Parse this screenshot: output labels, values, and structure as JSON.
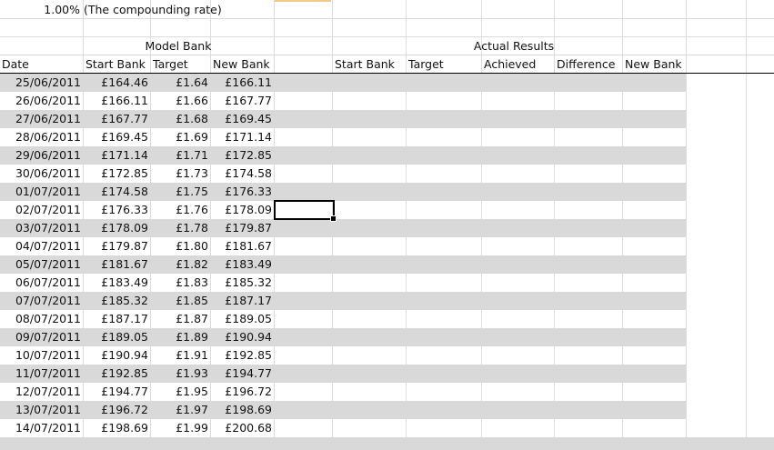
{
  "top": {
    "rate_value": "1.00%",
    "rate_note": "(The compounding rate)"
  },
  "headers": {
    "model_bank": "Model Bank",
    "actual_results": "Actual Results",
    "date": "Date",
    "start_bank": "Start Bank",
    "target": "Target",
    "new_bank": "New Bank",
    "actual_start_bank": "Start Bank",
    "actual_target": "Target",
    "achieved": "Achieved",
    "difference": "Difference",
    "actual_new_bank": "New Bank"
  },
  "rows": [
    {
      "date": "25/06/2011",
      "start": "£164.46",
      "target": "£1.64",
      "new": "£166.11"
    },
    {
      "date": "26/06/2011",
      "start": "£166.11",
      "target": "£1.66",
      "new": "£167.77"
    },
    {
      "date": "27/06/2011",
      "start": "£167.77",
      "target": "£1.68",
      "new": "£169.45"
    },
    {
      "date": "28/06/2011",
      "start": "£169.45",
      "target": "£1.69",
      "new": "£171.14"
    },
    {
      "date": "29/06/2011",
      "start": "£171.14",
      "target": "£1.71",
      "new": "£172.85"
    },
    {
      "date": "30/06/2011",
      "start": "£172.85",
      "target": "£1.73",
      "new": "£174.58"
    },
    {
      "date": "01/07/2011",
      "start": "£174.58",
      "target": "£1.75",
      "new": "£176.33"
    },
    {
      "date": "02/07/2011",
      "start": "£176.33",
      "target": "£1.76",
      "new": "£178.09"
    },
    {
      "date": "03/07/2011",
      "start": "£178.09",
      "target": "£1.78",
      "new": "£179.87"
    },
    {
      "date": "04/07/2011",
      "start": "£179.87",
      "target": "£1.80",
      "new": "£181.67"
    },
    {
      "date": "05/07/2011",
      "start": "£181.67",
      "target": "£1.82",
      "new": "£183.49"
    },
    {
      "date": "06/07/2011",
      "start": "£183.49",
      "target": "£1.83",
      "new": "£185.32"
    },
    {
      "date": "07/07/2011",
      "start": "£185.32",
      "target": "£1.85",
      "new": "£187.17"
    },
    {
      "date": "08/07/2011",
      "start": "£187.17",
      "target": "£1.87",
      "new": "£189.05"
    },
    {
      "date": "09/07/2011",
      "start": "£189.05",
      "target": "£1.89",
      "new": "£190.94"
    },
    {
      "date": "10/07/2011",
      "start": "£190.94",
      "target": "£1.91",
      "new": "£192.85"
    },
    {
      "date": "11/07/2011",
      "start": "£192.85",
      "target": "£1.93",
      "new": "£194.77"
    },
    {
      "date": "12/07/2011",
      "start": "£194.77",
      "target": "£1.95",
      "new": "£196.72"
    },
    {
      "date": "13/07/2011",
      "start": "£196.72",
      "target": "£1.97",
      "new": "£198.69"
    },
    {
      "date": "14/07/2011",
      "start": "£198.69",
      "target": "£1.99",
      "new": "£200.68"
    }
  ],
  "colors": {
    "stripe": "#d9d9d9",
    "gridline": "#dadcdd"
  }
}
